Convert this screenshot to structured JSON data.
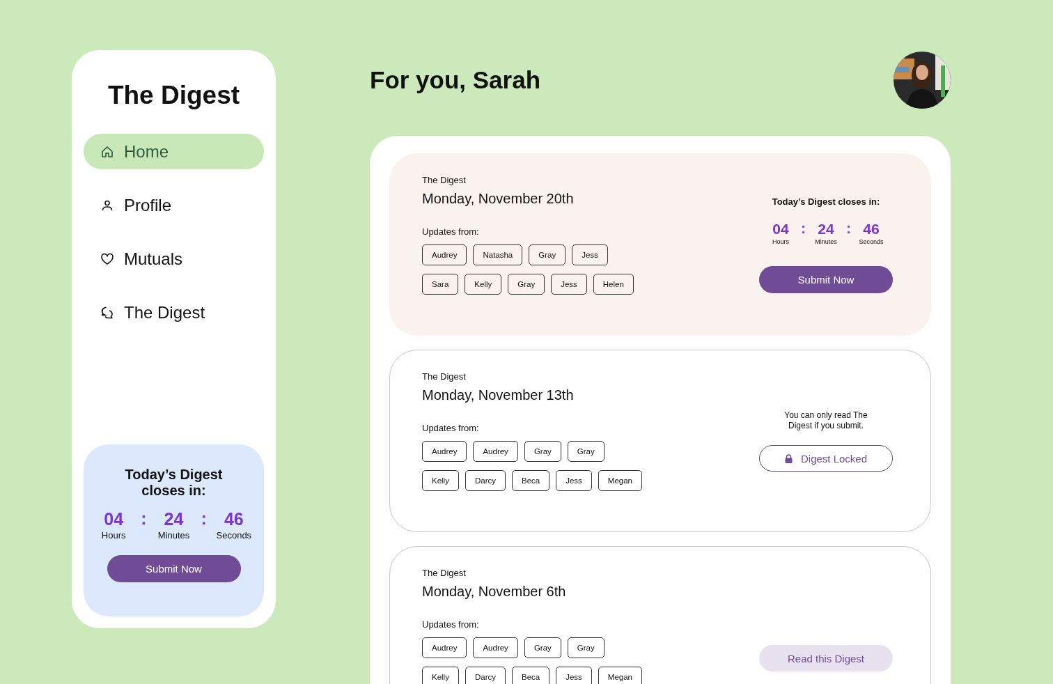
{
  "sidebar": {
    "title": "The Digest",
    "items": [
      {
        "label": "Home",
        "selected": true
      },
      {
        "label": "Profile",
        "selected": false
      },
      {
        "label": "Mutuals",
        "selected": false
      },
      {
        "label": "The Digest",
        "selected": false
      }
    ],
    "countdown_card": {
      "title": "Today’s Digest closes in:",
      "separator": ":",
      "units": [
        {
          "value": "04",
          "label": "Hours"
        },
        {
          "value": "24",
          "label": "Minutes"
        },
        {
          "value": "46",
          "label": "Seconds"
        }
      ],
      "button": "Submit Now"
    }
  },
  "header": {
    "greeting": "For you, Sarah"
  },
  "cards": [
    {
      "kind": "open",
      "label": "The Digest",
      "date": "Monday, November 20th",
      "updates_label": "Updates from:",
      "chip_rows": [
        [
          "Audrey",
          "Natasha",
          "Gray",
          "Jess"
        ],
        [
          "Sara",
          "Kelly",
          "Gray",
          "Jess",
          "Helen"
        ]
      ],
      "closes_title": "Today’s Digest closes in:",
      "separator": ":",
      "units": [
        {
          "value": "04",
          "label": "Hours"
        },
        {
          "value": "24",
          "label": "Minutes"
        },
        {
          "value": "46",
          "label": "Seconds"
        }
      ],
      "button": "Submit Now"
    },
    {
      "kind": "locked",
      "label": "The Digest",
      "date": "Monday, November 13th",
      "updates_label": "Updates from:",
      "chip_rows": [
        [
          "Audrey",
          "Audrey",
          "Gray",
          "Gray"
        ],
        [
          "Kelly",
          "Darcy",
          "Beca",
          "Jess",
          "Megan"
        ]
      ],
      "note": "You can only read The Digest if you submit.",
      "button": "Digest Locked"
    },
    {
      "kind": "read",
      "label": "The Digest",
      "date": "Monday, November 6th",
      "updates_label": "Updates from:",
      "chip_rows": [
        [
          "Audrey",
          "Audrey",
          "Gray",
          "Gray"
        ],
        [
          "Kelly",
          "Darcy",
          "Beca",
          "Jess",
          "Megan"
        ]
      ],
      "button": "Read this Digest"
    }
  ]
}
